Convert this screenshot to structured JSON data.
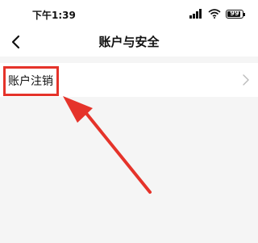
{
  "status_bar": {
    "time": "下午1:39",
    "battery_level": "99",
    "icons": [
      "signal-icon",
      "wifi-icon",
      "battery-icon"
    ]
  },
  "nav": {
    "back_icon": "chevron-left-icon",
    "title": "账户与安全"
  },
  "list": {
    "items": [
      {
        "label": "账户注销",
        "icon": "chevron-right-icon"
      }
    ]
  },
  "annotation": {
    "highlight_color": "#e5332a"
  }
}
